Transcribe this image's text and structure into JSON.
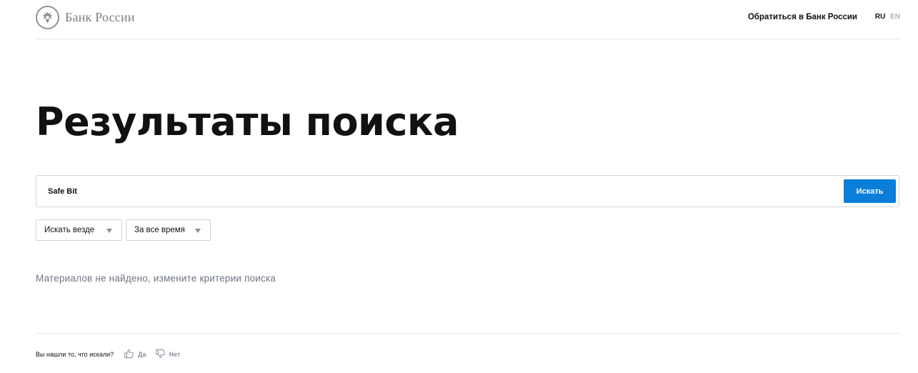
{
  "header": {
    "logo_text": "Банк России",
    "logo_icon": "bank-emblem-icon",
    "contact_link": "Обратиться в Банк России",
    "lang_ru": "RU",
    "lang_en": "EN"
  },
  "main": {
    "title": "Результаты поиска",
    "search": {
      "value": "Safe Bit",
      "button_label": "Искать"
    },
    "filters": {
      "where": "Искать везде",
      "time": "За все время"
    },
    "no_results": "Материалов не найдено, измените критерии поиска"
  },
  "feedback": {
    "question": "Вы нашли то, что искали?",
    "yes_label": "Да",
    "no_label": "Нет",
    "yes_icon": "thumbs-up-icon",
    "no_icon": "thumbs-down-icon"
  },
  "colors": {
    "accent": "#0a7ed8",
    "muted_text": "#6c7580",
    "border": "#cfd3d8"
  }
}
